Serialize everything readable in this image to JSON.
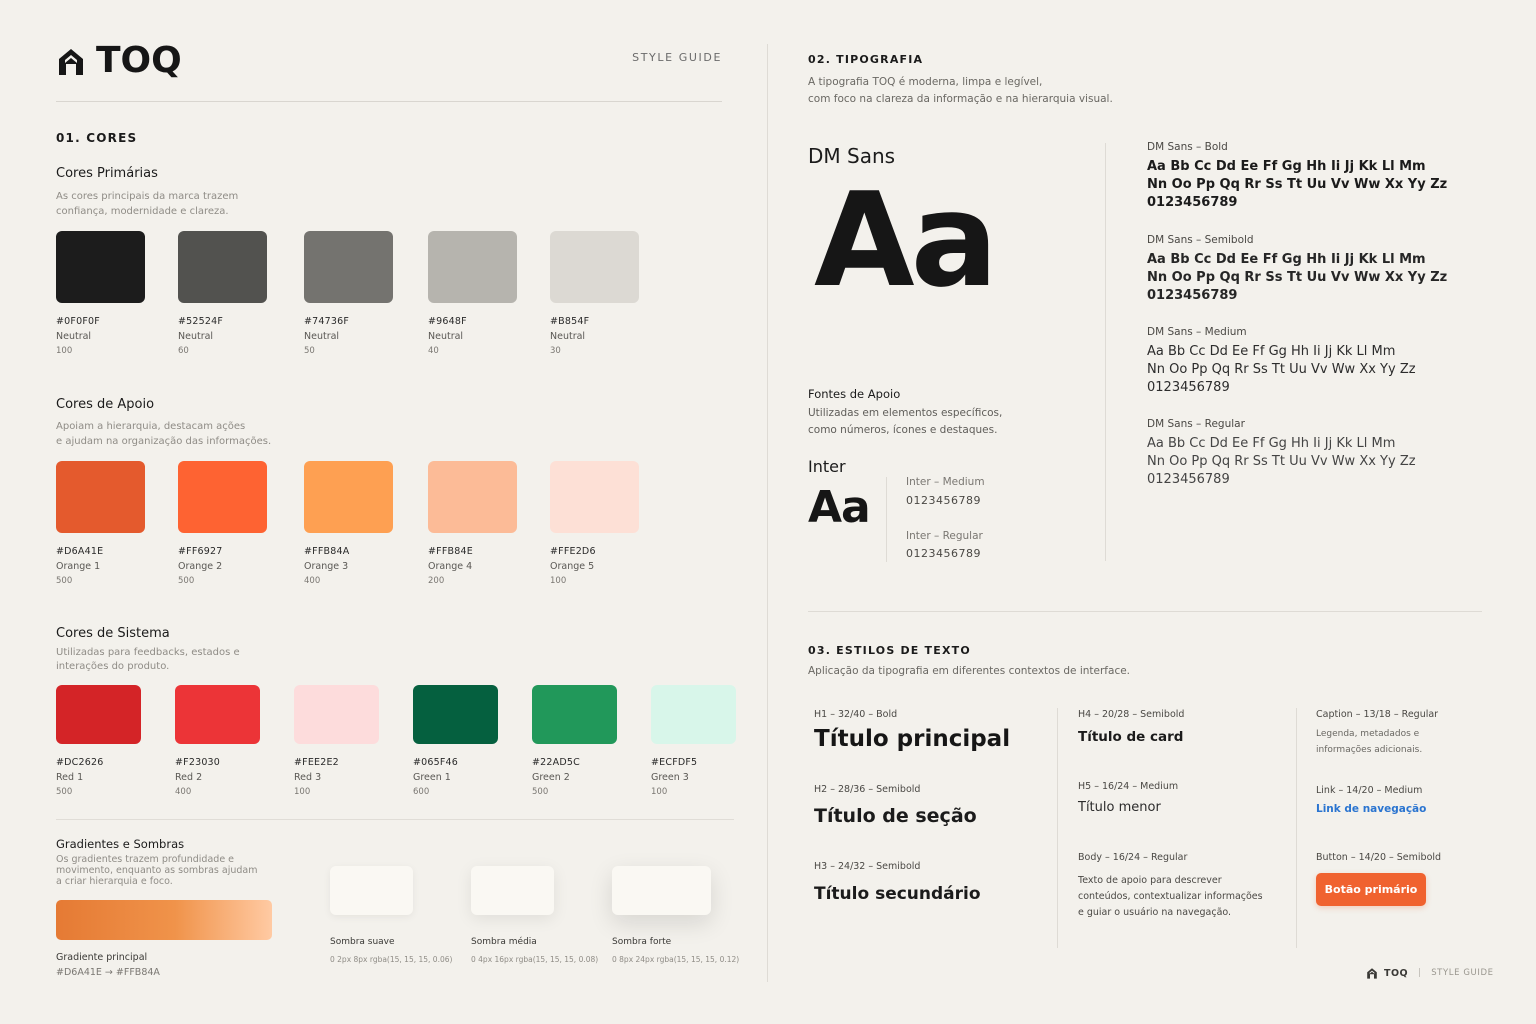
{
  "brand": {
    "name": "TOQ",
    "guide_label": "STYLE GUIDE"
  },
  "colors": {
    "section": "01. CORES",
    "primary": {
      "title": "Cores Primárias",
      "desc_1": "As cores principais da marca trazem",
      "desc_2": "confiança, modernidade e clareza.",
      "swatches": [
        {
          "hex": "#0F0F0F",
          "name": "Neutral",
          "level": "100",
          "color": "#1c1c1c"
        },
        {
          "hex": "#52524F",
          "name": "Neutral",
          "level": "60",
          "color": "#52524f"
        },
        {
          "hex": "#74736F",
          "name": "Neutral",
          "level": "50",
          "color": "#74736f"
        },
        {
          "hex": "#9648F",
          "name": "Neutral",
          "level": "40",
          "color": "#b6b4ae"
        },
        {
          "hex": "#B854F",
          "name": "Neutral",
          "level": "30",
          "color": "#dcd9d3"
        }
      ]
    },
    "support": {
      "title": "Cores de Apoio",
      "desc_1": "Apoiam a hierarquia, destacam ações",
      "desc_2": "e ajudam na organização das informações.",
      "swatches": [
        {
          "hex": "#D6A41E",
          "name": "Orange 1",
          "level": "500",
          "color": "#e45a2d"
        },
        {
          "hex": "#FF6927",
          "name": "Orange 2",
          "level": "500",
          "color": "#fe6332"
        },
        {
          "hex": "#FFB84A",
          "name": "Orange 3",
          "level": "400",
          "color": "#fea052"
        },
        {
          "hex": "#FFB84E",
          "name": "Orange 4",
          "level": "200",
          "color": "#fcbb97"
        },
        {
          "hex": "#FFE2D6",
          "name": "Orange 5",
          "level": "100",
          "color": "#fde0d6"
        }
      ]
    },
    "system": {
      "title": "Cores de Sistema",
      "desc_1": "Utilizadas para feedbacks, estados e",
      "desc_2": "interações do produto.",
      "swatches": [
        {
          "hex": "#DC2626",
          "name": "Red 1",
          "level": "500",
          "color": "#d42427"
        },
        {
          "hex": "#F23030",
          "name": "Red 2",
          "level": "400",
          "color": "#ec3437"
        },
        {
          "hex": "#FEE2E2",
          "name": "Red 3",
          "level": "100",
          "color": "#fddcdc"
        },
        {
          "hex": "#065F46",
          "name": "Green 1",
          "level": "600",
          "color": "#05603f"
        },
        {
          "hex": "#22AD5C",
          "name": "Green 2",
          "level": "500",
          "color": "#21985a"
        },
        {
          "hex": "#ECFDF5",
          "name": "Green 3",
          "level": "100",
          "color": "#d8f6ea"
        }
      ]
    },
    "gradients": {
      "title": "Gradientes e Sombras",
      "desc_1": "Os gradientes trazem profundidade e",
      "desc_2": "movimento, enquanto as sombras ajudam",
      "desc_3": "a criar hierarquia e foco.",
      "gradient_label": "Gradiente principal",
      "gradient_value": "#D6A41E → #FFB84A",
      "shadows": [
        {
          "label": "Sombra suave",
          "value": "0 2px 8px rgba(15, 15, 15, 0.06)"
        },
        {
          "label": "Sombra média",
          "value": "0 4px 16px rgba(15, 15, 15, 0.08)"
        },
        {
          "label": "Sombra forte",
          "value": "0 8px 24px rgba(15, 15, 15, 0.12)"
        }
      ]
    }
  },
  "typography": {
    "section": "02. TIPOGRAFIA",
    "intro_1": "A tipografia TOQ é moderna, limpa e legível,",
    "intro_2": "com foco na clareza da informação e na hierarquia visual.",
    "primary_font": "DM Sans",
    "sample": "Aa",
    "weights": [
      {
        "label": "DM Sans – Bold",
        "line1": "Aa Bb Cc Dd Ee Ff Gg Hh Ii Jj Kk Ll Mm",
        "line2": "Nn Oo Pp Qq Rr Ss Tt Uu Vv Ww Xx Yy Zz",
        "line3": "0123456789"
      },
      {
        "label": "DM Sans – Semibold",
        "line1": "Aa Bb Cc Dd Ee Ff Gg Hh Ii Jj Kk Ll Mm",
        "line2": "Nn Oo Pp Qq Rr Ss Tt Uu Vv Ww Xx Yy Zz",
        "line3": "0123456789"
      },
      {
        "label": "DM Sans – Medium",
        "line1": "Aa Bb Cc Dd Ee Ff Gg Hh Ii Jj Kk Ll Mm",
        "line2": "Nn Oo Pp Qq Rr Ss Tt Uu Vv Ww Xx Yy Zz",
        "line3": "0123456789"
      },
      {
        "label": "DM Sans – Regular",
        "line1": "Aa Bb Cc Dd Ee Ff Gg Hh Ii Jj Kk Ll Mm",
        "line2": "Nn Oo Pp Qq Rr Ss Tt Uu Vv Ww Xx Yy Zz",
        "line3": "0123456789"
      }
    ],
    "support": {
      "title": "Fontes de Apoio",
      "desc_1": "Utilizadas em elementos específicos,",
      "desc_2": "como números, ícones e destaques.",
      "font": "Inter",
      "sample": "Aa",
      "medium_label": "Inter – Medium",
      "medium_value": "0123456789",
      "regular_label": "Inter – Regular",
      "regular_value": "0123456789"
    }
  },
  "text_styles": {
    "section": "03. ESTILOS DE TEXTO",
    "intro": "Aplicação da tipografia em diferentes contextos de interface.",
    "h1": {
      "spec": "H1 – 32/40 – Bold",
      "text": "Título principal"
    },
    "h2": {
      "spec": "H2 – 28/36 – Semibold",
      "text": "Título de seção"
    },
    "h3": {
      "spec": "H3 – 24/32 – Semibold",
      "text": "Título secundário"
    },
    "h4": {
      "spec": "H4 – 20/28 – Semibold",
      "text": "Título de card"
    },
    "h5": {
      "spec": "H5 – 16/24 – Medium",
      "text": "Título menor"
    },
    "body": {
      "spec": "Body – 16/24 – Regular",
      "line1": "Texto de apoio para descrever",
      "line2": "conteúdos, contextualizar informações",
      "line3": "e guiar o usuário na navegação."
    },
    "caption": {
      "spec": "Caption – 13/18 – Regular",
      "line1": "Legenda, metadados e",
      "line2": "informações adicionais."
    },
    "link": {
      "spec": "Link – 14/20 – Medium",
      "text": "Link de navegação"
    },
    "button": {
      "spec": "Button – 14/20 – Semibold",
      "text": "Botão primário"
    }
  },
  "footer": {
    "brand": "TOQ",
    "sep": "|",
    "label": "STYLE GUIDE"
  },
  "accent": "#F0622F",
  "link_color": "#2A74D0"
}
